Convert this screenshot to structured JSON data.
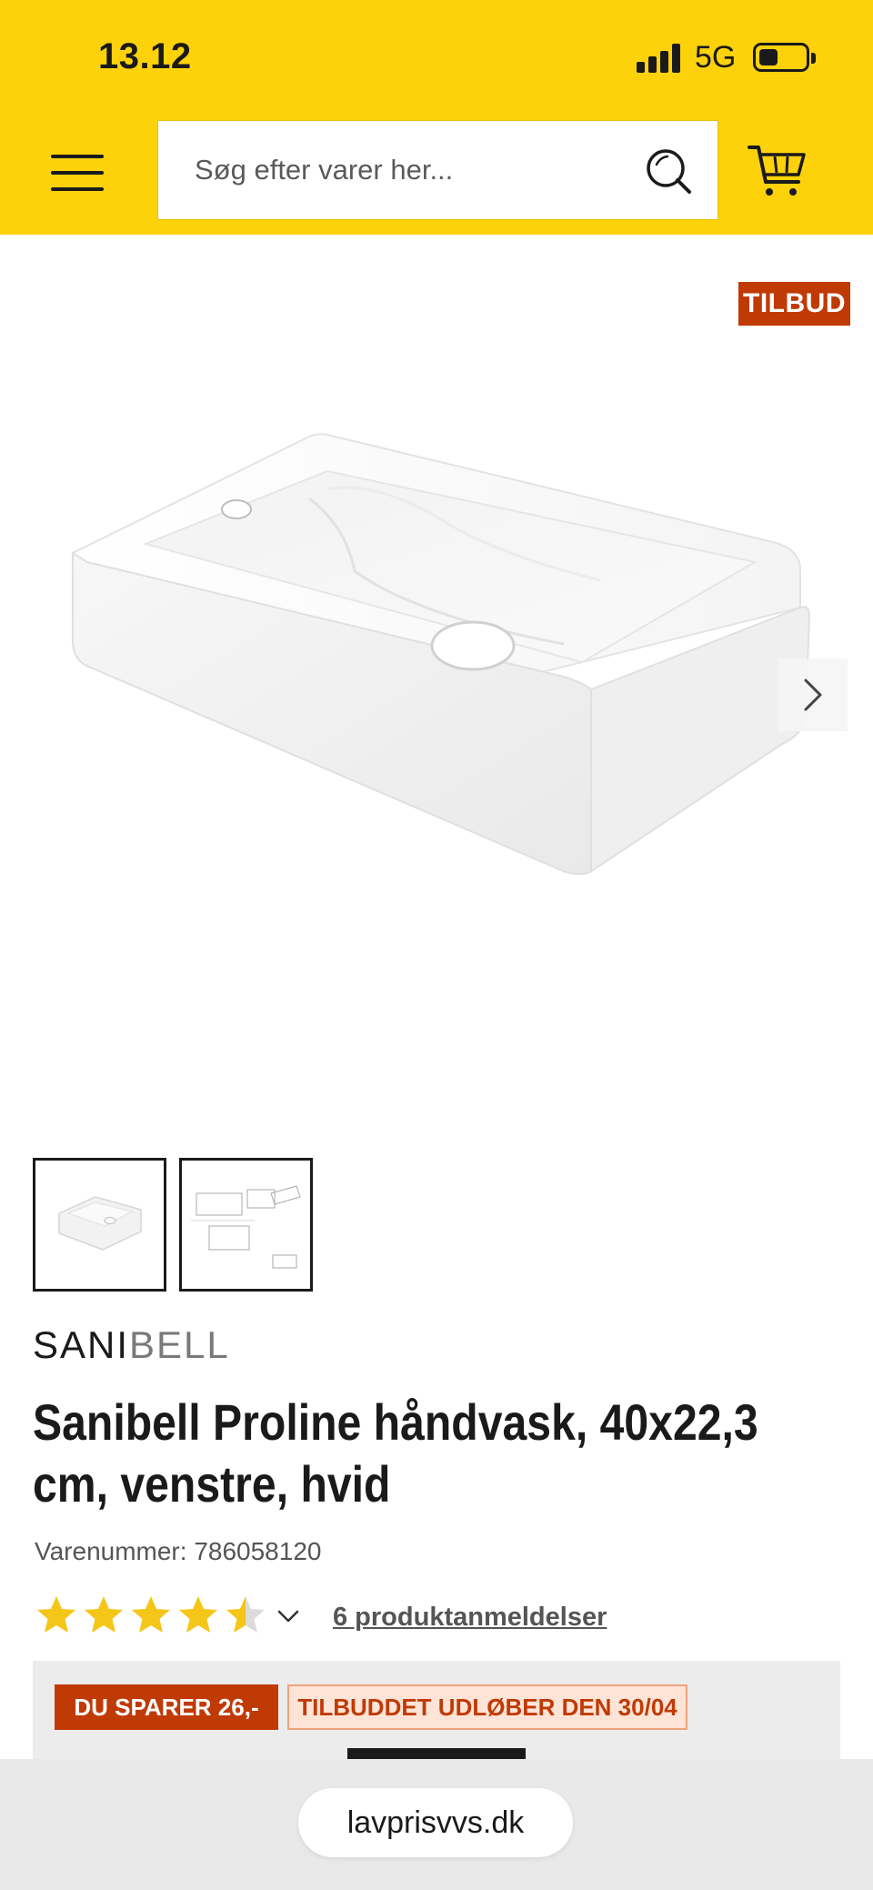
{
  "status_bar": {
    "time": "13.12",
    "network": "5G"
  },
  "header": {
    "search_placeholder": "Søg efter varer her..."
  },
  "product": {
    "badge": "TILBUD",
    "brand_part1": "SANI",
    "brand_part2": "BELL",
    "title": "Sanibell Proline håndvask, 40x22,3 cm, venstre, hvid",
    "sku": "Varenummer: 786058120",
    "rating": 4.5,
    "reviews_link": "6 produktanmeldelser",
    "thumbnails": [
      "image-sink",
      "image-technical-drawing"
    ]
  },
  "offer": {
    "savings": "DU SPARER 26,-",
    "expires": "TILBUDDET UDLØBER DEN 30/04"
  },
  "browser": {
    "url": "lavprisvvs.dk"
  },
  "colors": {
    "brand_yellow": "#fdd20a",
    "offer_red": "#c03a06",
    "star_yellow": "#f5c518"
  }
}
